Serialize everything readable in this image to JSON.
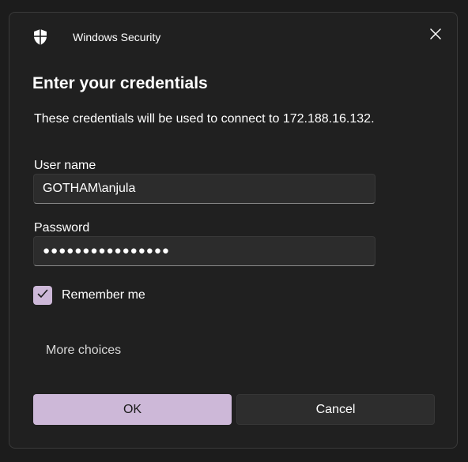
{
  "window": {
    "app_title": "Windows Security",
    "close_icon": "close-icon",
    "shield_icon": "shield-icon"
  },
  "dialog": {
    "heading": "Enter your credentials",
    "description": "These credentials will be used to connect to 172.188.16.132."
  },
  "form": {
    "username_label": "User name",
    "username_value": "GOTHAM\\anjula",
    "password_label": "Password",
    "password_value": "●●●●●●●●●●●●●●●●",
    "remember_label": "Remember me",
    "remember_checked": true,
    "more_choices": "More choices"
  },
  "buttons": {
    "ok": "OK",
    "cancel": "Cancel"
  },
  "colors": {
    "accent": "#cdb8d8",
    "background": "#202020",
    "input_bg": "#2c2c2c"
  }
}
